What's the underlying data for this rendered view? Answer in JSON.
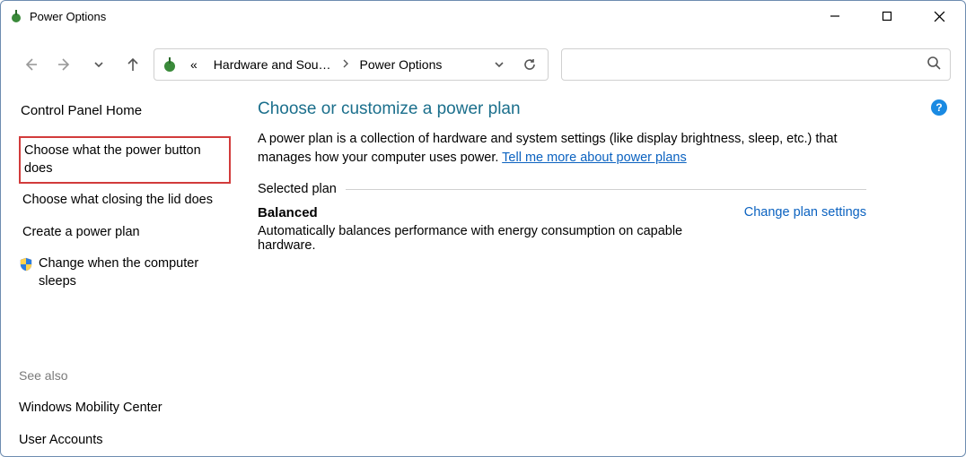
{
  "window": {
    "title": "Power Options"
  },
  "breadcrumb": {
    "prefix": "«",
    "items": [
      "Hardware and Sou…",
      "Power Options"
    ]
  },
  "sidebar": {
    "home": "Control Panel Home",
    "links": [
      "Choose what the power button does",
      "Choose what closing the lid does",
      "Create a power plan",
      "Change when the computer sleeps"
    ],
    "see_also_label": "See also",
    "see_also": [
      "Windows Mobility Center",
      "User Accounts"
    ]
  },
  "main": {
    "heading": "Choose or customize a power plan",
    "description_prefix": "A power plan is a collection of hardware and system settings (like display brightness, sleep, etc.) that manages how your computer uses power. ",
    "description_link": "Tell me more about power plans",
    "group_label": "Selected plan",
    "plan": {
      "name": "Balanced",
      "description": "Automatically balances performance with energy consumption on capable hardware.",
      "change_link": "Change plan settings"
    }
  },
  "help_glyph": "?"
}
